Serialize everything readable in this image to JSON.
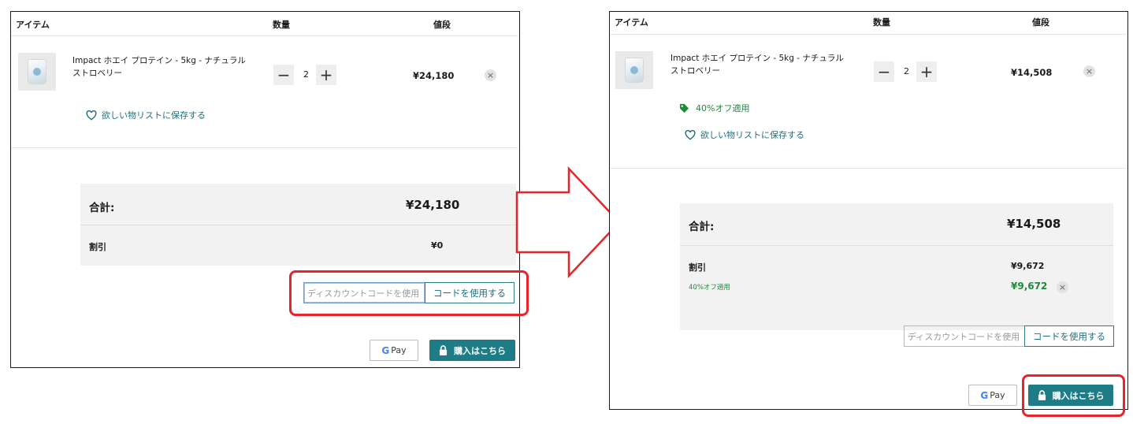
{
  "header": {
    "item": "アイテム",
    "qty": "数量",
    "price": "値段"
  },
  "product": {
    "name": "Impact ホエイ プロテイン - 5kg - ナチュラルストロベリー",
    "quantity": "2"
  },
  "wishlist_label": "欲しい物リストに保存する",
  "remove_glyph": "×",
  "before": {
    "line_price": "¥24,180",
    "total_label": "合計:",
    "total_value": "¥24,180",
    "discount_label": "割引",
    "discount_value": "¥0"
  },
  "after": {
    "line_price": "¥14,508",
    "promo_applied": "40%オフ適用",
    "total_label": "合計:",
    "total_value": "¥14,508",
    "discount_label": "割引",
    "discount_value": "¥9,672",
    "discount_detail_label": "40%オフ適用",
    "discount_detail_value": "¥9,672"
  },
  "discount_code": {
    "placeholder": "ディスカウントコードを使用",
    "apply_button": "コードを使用する"
  },
  "gpay": {
    "g": "G",
    "label": "Pay"
  },
  "checkout_button": "購入はこちら",
  "colors": {
    "accent": "#1d7c86",
    "highlight": "#e8242b",
    "promo_green": "#1f8a3a"
  }
}
